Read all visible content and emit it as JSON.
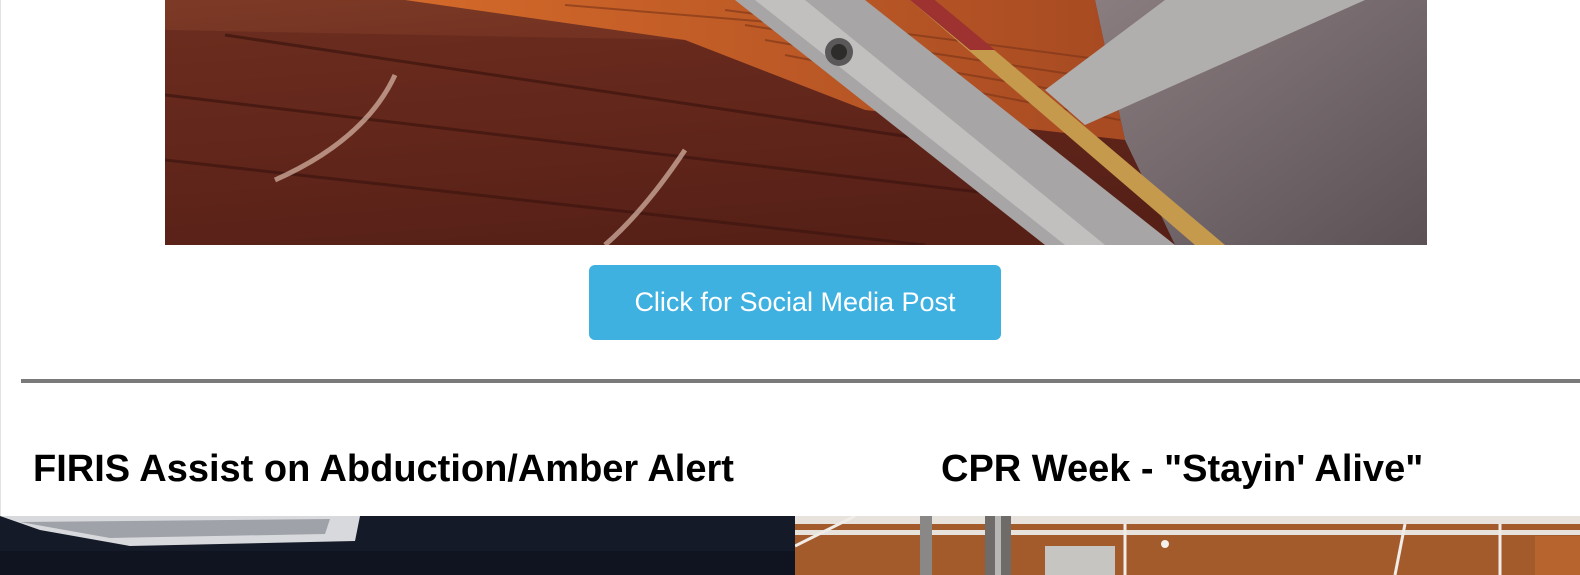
{
  "hero": {
    "image_alt": "Damaged roof eave with an aluminum ladder leaning against it"
  },
  "cta": {
    "label": "Click for Social Media Post",
    "color": "#3eb1e0"
  },
  "articles": [
    {
      "title": "FIRIS Assist on Abduction/Amber Alert",
      "image_alt": "Dark night aerial image"
    },
    {
      "title": "CPR Week - \"Stayin' Alive\"",
      "image_alt": "Fire station garage ceiling"
    }
  ]
}
